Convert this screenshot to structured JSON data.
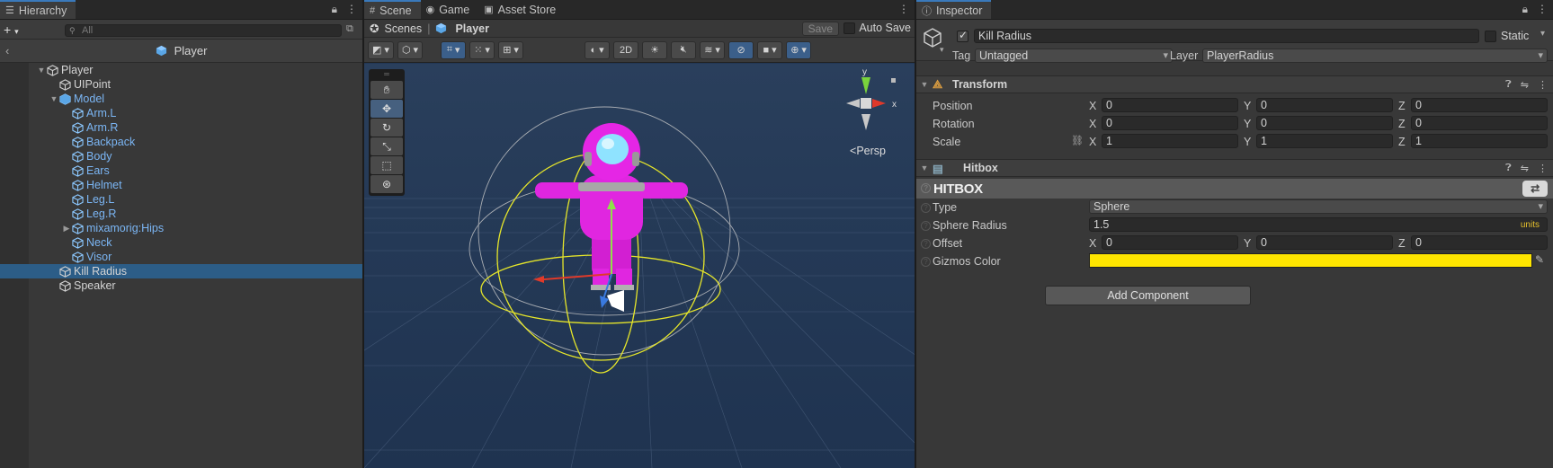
{
  "hierarchy": {
    "tab": "Hierarchy",
    "search_placeholder": "All",
    "breadcrumb": "Player",
    "items": [
      {
        "label": "Player",
        "depth": 0,
        "expanded": true
      },
      {
        "label": "UIPoint",
        "depth": 1
      },
      {
        "label": "Model",
        "depth": 1,
        "expanded": true,
        "blue": true
      },
      {
        "label": "Arm.L",
        "depth": 2,
        "blue": true
      },
      {
        "label": "Arm.R",
        "depth": 2,
        "blue": true
      },
      {
        "label": "Backpack",
        "depth": 2,
        "blue": true
      },
      {
        "label": "Body",
        "depth": 2,
        "blue": true
      },
      {
        "label": "Ears",
        "depth": 2,
        "blue": true
      },
      {
        "label": "Helmet",
        "depth": 2,
        "blue": true
      },
      {
        "label": "Leg.L",
        "depth": 2,
        "blue": true
      },
      {
        "label": "Leg.R",
        "depth": 2,
        "blue": true
      },
      {
        "label": "mixamorig:Hips",
        "depth": 2,
        "blue": true,
        "collapsed": true
      },
      {
        "label": "Neck",
        "depth": 2,
        "blue": true
      },
      {
        "label": "Visor",
        "depth": 2,
        "blue": true
      },
      {
        "label": "Kill Radius",
        "depth": 1,
        "selected": true
      },
      {
        "label": "Speaker",
        "depth": 1
      }
    ]
  },
  "scene": {
    "tabs": [
      "Scene",
      "Game",
      "Asset Store"
    ],
    "crumb_root": "Scenes",
    "crumb_current": "Player",
    "save_label": "Save",
    "autosave_label": "Auto Save",
    "mode_2d": "2D",
    "persp_label": "Persp",
    "gizmo_x": "x",
    "gizmo_y": "y"
  },
  "inspector": {
    "tab": "Inspector",
    "object_name": "Kill Radius",
    "static_label": "Static",
    "tag_label": "Tag",
    "tag_value": "Untagged",
    "layer_label": "Layer",
    "layer_value": "PlayerRadius",
    "transform": {
      "title": "Transform",
      "position": {
        "label": "Position",
        "x": "0",
        "y": "0",
        "z": "0"
      },
      "rotation": {
        "label": "Rotation",
        "x": "0",
        "y": "0",
        "z": "0"
      },
      "scale": {
        "label": "Scale",
        "x": "1",
        "y": "1",
        "z": "1"
      }
    },
    "hitbox": {
      "title": "Hitbox",
      "banner": "HITBOX",
      "type_label": "Type",
      "type_value": "Sphere",
      "radius_label": "Sphere Radius",
      "radius_value": "1.5",
      "radius_units": "units",
      "offset_label": "Offset",
      "offset": {
        "x": "0",
        "y": "0",
        "z": "0"
      },
      "gizmos_label": "Gizmos Color",
      "gizmos_color": "#ffe600"
    },
    "add_component": "Add Component",
    "axis": {
      "x": "X",
      "y": "Y",
      "z": "Z"
    }
  }
}
